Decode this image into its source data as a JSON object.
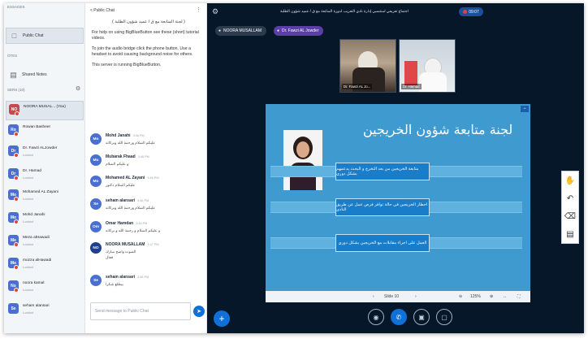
{
  "sidebar": {
    "section_messages": "ESSAGES",
    "public_chat": "Public Chat",
    "section_notes": "OTES",
    "shared_notes": "Shared Notes",
    "section_users": "SERS (10)",
    "users": [
      {
        "initials": "NO",
        "name": "NOORA MUSAL... (You)",
        "status": "",
        "color": "#c7484d"
      },
      {
        "initials": "Ro",
        "name": "Rowan Basheer",
        "status": "",
        "color": "#4a6fd1"
      },
      {
        "initials": "Dr",
        "name": "Dr. Fawzi ALJowder",
        "status": "Locked",
        "color": "#4a6fd1"
      },
      {
        "initials": "Dr",
        "name": "Dr. Hamad",
        "status": "Locked",
        "color": "#4a6fd1"
      },
      {
        "initials": "Mo",
        "name": "Mohamed AL Zayani",
        "status": "Locked",
        "color": "#4a6fd1"
      },
      {
        "initials": "Mo",
        "name": "Mohd Janahi",
        "status": "Locked",
        "color": "#4a6fd1"
      },
      {
        "initials": "Me",
        "name": "Meza alHawadi",
        "status": "Locked",
        "color": "#4a6fd1"
      },
      {
        "initials": "Mo",
        "name": "mozza alHawadi",
        "status": "Locked",
        "color": "#4a6fd1"
      },
      {
        "initials": "No",
        "name": "noora kamal",
        "status": "Locked",
        "color": "#4a6fd1"
      },
      {
        "initials": "Se",
        "name": "seham alansari",
        "status": "Locked",
        "color": "#4a6fd1"
      }
    ]
  },
  "chat": {
    "title": "< Public Chat",
    "welcome_ar": "( لجنة المتابعة مع ق / عميد شؤون الطلبة )",
    "welcome_help": "For help on using BigBlueButton see these (short) tutorial videos.",
    "welcome_audio": "To join the audio bridge click the phone button. Use a headset to avoid causing background noise for others.",
    "welcome_server": "This server is running BigBlueButton.",
    "messages": [
      {
        "initials": "Mo",
        "name": "Mohd Janahi",
        "time": "3:46 PM",
        "text": "عليكم السلام ورحمة الله وبركاته",
        "text2": ""
      },
      {
        "initials": "Mu",
        "name": "Mubarak Fhaad",
        "time": "3:46 PM",
        "text": "و عليكم السلام",
        "text2": ""
      },
      {
        "initials": "Mo",
        "name": "Mohamed AL Zayani",
        "time": "3:46 PM",
        "text": "عليكم السلام دكتور",
        "text2": ""
      },
      {
        "initials": "Se",
        "name": "seham alansari",
        "time": "3:46 PM",
        "text": "عليكم السلام ورحمة الله وبركاته",
        "text2": ""
      },
      {
        "initials": "Om",
        "name": "Omar Hamdan",
        "time": "3:46 PM",
        "text": "و عليكم السلام و رحمة الله و بركاته",
        "text2": ""
      },
      {
        "initials": "NO",
        "name": "NOORA MUSALLAM",
        "time": "3:47 PM",
        "text": "الصوت واضح مبارك",
        "text2": "فعال"
      },
      {
        "initials": "Se",
        "name": "seham alansari",
        "time": "3:48 PM",
        "text": "بيطلع شكرا",
        "text2": ""
      }
    ],
    "input_placeholder": "Send message to Public Chat",
    "send_icon": "send-icon"
  },
  "main": {
    "meeting_title": "اجتماع تعريفي لمنتسبي إدارة نادي التعريب لدورة المتابعة مع ق / عميد شؤون الطلبة",
    "timer": "09:07",
    "talkers": [
      {
        "name": "NOORA MUSALLAM",
        "color": "#2b3a4d"
      },
      {
        "name": "Dr. Fawzi AL Jowder",
        "color": "#5a3fa8"
      }
    ],
    "videos": [
      {
        "label": "Dr. Fawzi AL Jo..."
      },
      {
        "label": "Dr. Hamad"
      }
    ],
    "slide": {
      "title": "لجنة متابعة شؤون الخريجين",
      "items": [
        "متابعة الخريجين من بعد التخرج و البحث يدعمهم بشكل دوري",
        "اخطار الخريجين في حالة توافر فرص عمل عن طريق النادي",
        "العمل على اجراء مقابلات مع الخريجين بشكل دوري"
      ],
      "slide_label": "Slide 10",
      "zoom": "125%"
    }
  },
  "colors": {
    "accent": "#0f70d7",
    "main_bg": "#06172a",
    "slide_bg": "#3f9ad0"
  }
}
